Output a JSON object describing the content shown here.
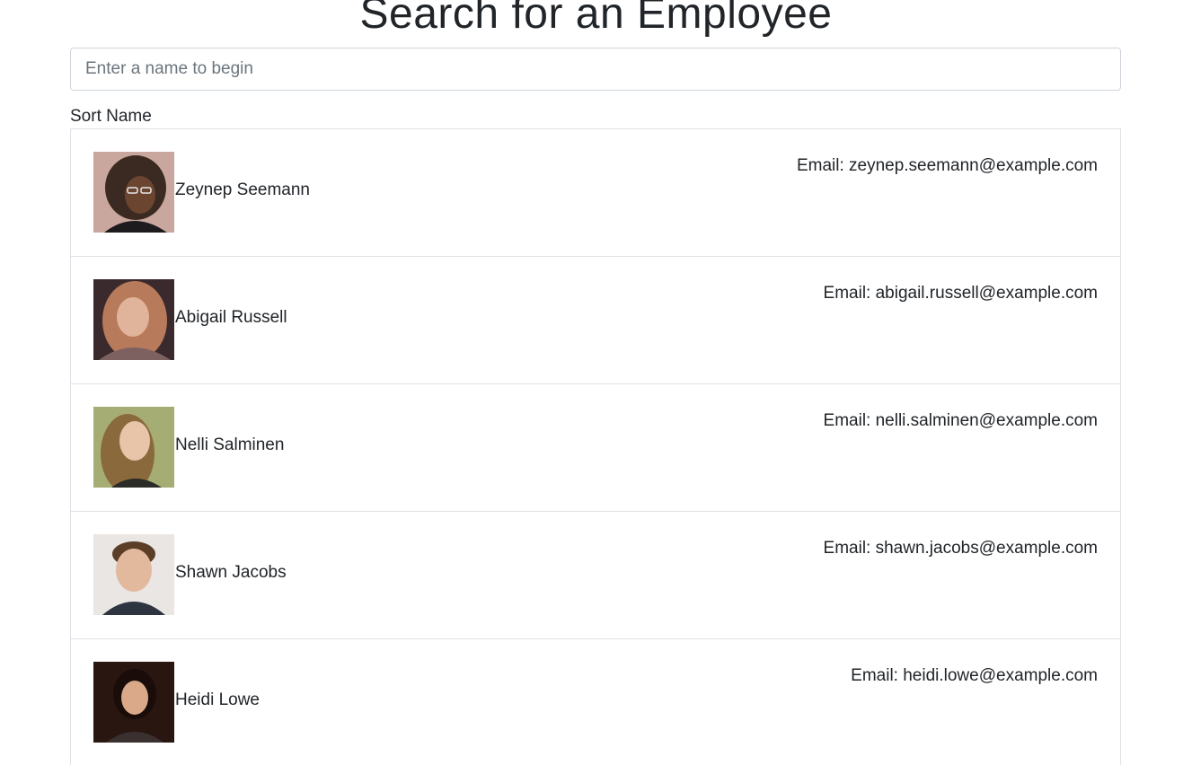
{
  "header": {
    "title": "Search for an Employee"
  },
  "search": {
    "placeholder": "Enter a name to begin",
    "value": ""
  },
  "sort": {
    "label": "Sort Name"
  },
  "employees": [
    {
      "name": "Zeynep Seemann",
      "email": "Email: zeynep.seemann@example.com",
      "photo": {
        "bg": "#c9a79e",
        "hair": "#3a2a22",
        "skin": "#6b4530",
        "shirt": "#1d1b1d"
      }
    },
    {
      "name": "Abigail Russell",
      "email": "Email: abigail.russell@example.com",
      "photo": {
        "bg": "#3b2a2d",
        "hair": "#b77a5a",
        "skin": "#e0b49a",
        "shirt": "#7d6161"
      }
    },
    {
      "name": "Nelli Salminen",
      "email": "Email: nelli.salminen@example.com",
      "photo": {
        "bg": "#a6ad74",
        "hair": "#8a6a3c",
        "skin": "#e8c4a8",
        "shirt": "#2b2b27"
      }
    },
    {
      "name": "Shawn Jacobs",
      "email": "Email: shawn.jacobs@example.com",
      "photo": {
        "bg": "#e9e6e3",
        "hair": "#5c3e27",
        "skin": "#e3b99e",
        "shirt": "#2e3540"
      }
    },
    {
      "name": "Heidi Lowe",
      "email": "Email: heidi.lowe@example.com",
      "photo": {
        "bg": "#2a1610",
        "hair": "#1a0d09",
        "skin": "#d9a98a",
        "shirt": "#3a3030"
      }
    }
  ]
}
